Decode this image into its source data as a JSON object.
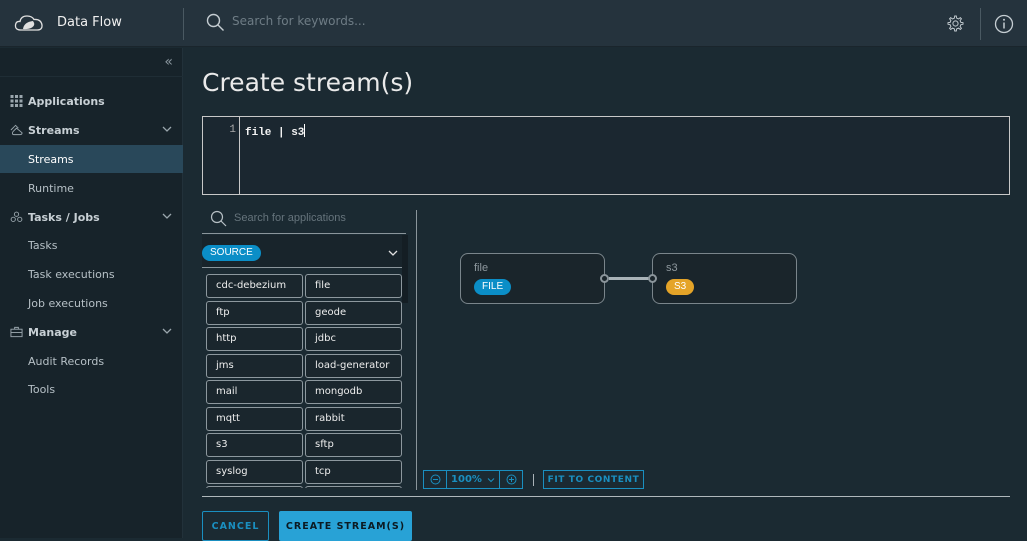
{
  "header": {
    "brand": "Data Flow",
    "search_placeholder": "Search for keywords...",
    "icons": [
      "spring-cloud-logo",
      "search-icon",
      "gear-icon",
      "info-icon"
    ]
  },
  "sidebar": {
    "collapse_icon": "double-chevron-left",
    "items": [
      {
        "label": "Applications",
        "type": "group",
        "icon": "grid-icon"
      },
      {
        "label": "Streams",
        "type": "group",
        "icon": "streams-icon",
        "expanded": true
      },
      {
        "label": "Streams",
        "type": "sub",
        "active": true
      },
      {
        "label": "Runtime",
        "type": "sub"
      },
      {
        "label": "Tasks / Jobs",
        "type": "group",
        "icon": "tasks-icon",
        "expanded": true
      },
      {
        "label": "Tasks",
        "type": "sub"
      },
      {
        "label": "Task executions",
        "type": "sub"
      },
      {
        "label": "Job executions",
        "type": "sub"
      },
      {
        "label": "Manage",
        "type": "group",
        "icon": "briefcase-icon",
        "expanded": true
      },
      {
        "label": "Audit Records",
        "type": "sub"
      },
      {
        "label": "Tools",
        "type": "sub"
      }
    ]
  },
  "main": {
    "title": "Create stream(s)",
    "editor": {
      "line_number": "1",
      "code": "file | s3"
    },
    "palette": {
      "search_placeholder": "Search for applications",
      "category": "SOURCE",
      "apps": [
        "cdc-debezium",
        "file",
        "ftp",
        "geode",
        "http",
        "jdbc",
        "jms",
        "load-generator",
        "mail",
        "mongodb",
        "mqtt",
        "rabbit",
        "s3",
        "sftp",
        "syslog",
        "tcp"
      ]
    },
    "graph": {
      "nodes": [
        {
          "name": "file",
          "badge": "FILE",
          "badge_color": "#0b8ec7"
        },
        {
          "name": "s3",
          "badge": "S3",
          "badge_color": "#e5a428"
        }
      ],
      "links": [
        {
          "from": "file",
          "to": "s3"
        }
      ]
    },
    "zoom": {
      "level": "100%",
      "zoom_out_icon": "minus-circle-icon",
      "zoom_in_icon": "plus-circle-icon",
      "fit_label": "FIT TO CONTENT"
    },
    "actions": {
      "cancel": "CANCEL",
      "create": "CREATE STREAM(S)"
    }
  },
  "colors": {
    "accent": "#1a8fc0",
    "primary_button": "#28a2d6",
    "active_nav": "#29485a",
    "source_badge": "#0b8ec7",
    "sink_badge": "#e5a428"
  }
}
